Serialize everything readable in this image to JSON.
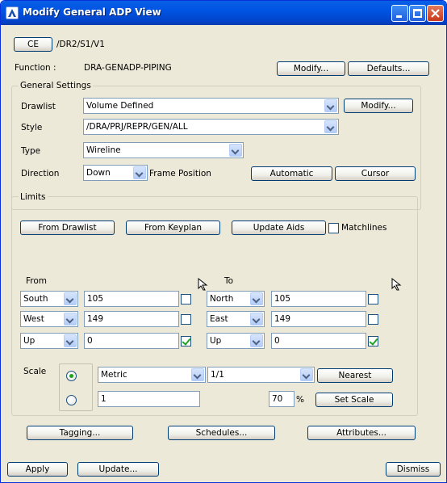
{
  "window": {
    "title": "Modify General ADP View"
  },
  "ce": {
    "button_label": "CE",
    "path": "/DR2/S1/V1"
  },
  "function": {
    "label": "Function :",
    "value": "DRA-GENADP-PIPING",
    "modify_label": "Modify...",
    "defaults_label": "Defaults..."
  },
  "general": {
    "group_label": "General Settings",
    "drawlist_label": "Drawlist",
    "drawlist_value": "Volume Defined",
    "drawlist_modify_label": "Modify...",
    "style_label": "Style",
    "style_value": "/DRA/PRJ/REPR/GEN/ALL",
    "type_label": "Type",
    "type_value": "Wireline",
    "direction_label": "Direction",
    "direction_value": "Down",
    "frame_position_label": "Frame Position",
    "automatic_label": "Automatic",
    "cursor_label": "Cursor"
  },
  "limits": {
    "group_label": "Limits",
    "from_drawlist_label": "From Drawlist",
    "from_keyplan_label": "From Keyplan",
    "update_aids_label": "Update Aids",
    "matchlines_label": "Matchlines",
    "matchlines_checked": false,
    "from_label": "From",
    "to_label": "To",
    "from_rows": [
      {
        "dir": "South",
        "value": "105",
        "checked": false
      },
      {
        "dir": "West",
        "value": "149",
        "checked": false
      },
      {
        "dir": "Up",
        "value": "0",
        "checked": true
      }
    ],
    "to_rows": [
      {
        "dir": "North",
        "value": "105",
        "checked": false
      },
      {
        "dir": "East",
        "value": "149",
        "checked": false
      },
      {
        "dir": "Up",
        "value": "0",
        "checked": true
      }
    ]
  },
  "scale": {
    "label": "Scale",
    "units_value": "Metric",
    "ratio_value": "1/1",
    "nearest_label": "Nearest",
    "custom_value": "1",
    "percent_value": "70",
    "percent_symbol": "%",
    "set_scale_label": "Set Scale",
    "selected_option": 1
  },
  "bottom_row": {
    "tagging_label": "Tagging...",
    "schedules_label": "Schedules...",
    "attributes_label": "Attributes..."
  },
  "footer": {
    "apply_label": "Apply",
    "update_label": "Update...",
    "dismiss_label": "Dismiss"
  },
  "colors": {
    "titlebar": "#0054E3",
    "face": "#ECE9D8",
    "field_border": "#7F9DB9",
    "check": "#21A121"
  }
}
